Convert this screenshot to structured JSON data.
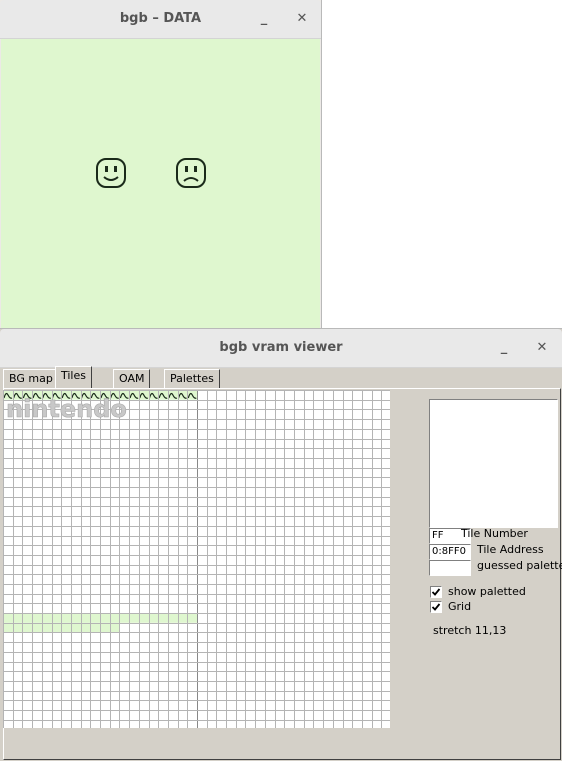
{
  "data_window": {
    "title": "bgb – DATA",
    "minimize_label": "_",
    "close_label": "✕",
    "screen_color": "#dff7cf",
    "faces": [
      "smiling-face-icon",
      "frowning-face-icon"
    ]
  },
  "vram_window": {
    "title": "bgb vram viewer",
    "minimize_label": "_",
    "close_label": "✕",
    "tabs": [
      {
        "label": "BG map",
        "active": false
      },
      {
        "label": "Tiles",
        "active": true
      },
      {
        "label": "OAM",
        "active": false
      },
      {
        "label": "Palettes",
        "active": false
      }
    ],
    "tile_number": {
      "value": "FF",
      "label": "Tile Number"
    },
    "tile_address": {
      "value": "0:8FF0",
      "label": "Tile Address"
    },
    "guessed_palette": {
      "value": "",
      "label": "guessed palette"
    },
    "show_paletted": {
      "label": "show paletted",
      "checked": true
    },
    "grid": {
      "label": "Grid",
      "checked": true
    },
    "stretch": "stretch 11,13",
    "tile_logo_text": "nintendo",
    "colors": {
      "tile_highlight": "#dff7cf",
      "grid_line": "#b4b4b4",
      "tile_ink": "#1a2a1a"
    }
  }
}
